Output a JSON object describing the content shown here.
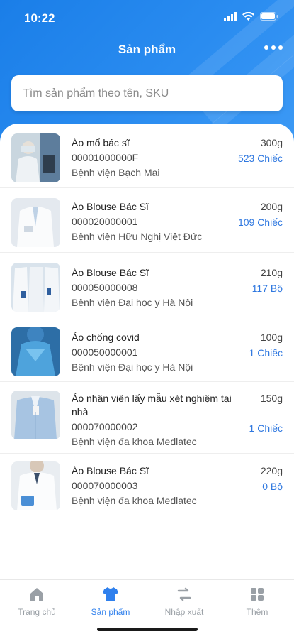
{
  "status": {
    "time": "10:22"
  },
  "header": {
    "title": "Sản phẩm"
  },
  "search": {
    "placeholder": "Tìm sản phẩm theo tên, SKU"
  },
  "products": [
    {
      "name": "Áo mổ bác sĩ",
      "sku": "00001000000F",
      "hospital": "Bệnh viện Bạch Mai",
      "weight": "300g",
      "quantity": "523 Chiếc"
    },
    {
      "name": "Áo Blouse Bác Sĩ",
      "sku": "000020000001",
      "hospital": "Bệnh viện Hữu Nghị Việt Đức",
      "weight": "200g",
      "quantity": "109 Chiếc"
    },
    {
      "name": "Áo Blouse Bác Sĩ",
      "sku": "000050000008",
      "hospital": "Bệnh viện Đại học y Hà Nội",
      "weight": "210g",
      "quantity": "117 Bộ"
    },
    {
      "name": "Áo chống covid",
      "sku": "000050000001",
      "hospital": "Bệnh viện Đại học y Hà Nội",
      "weight": "100g",
      "quantity": "1 Chiếc"
    },
    {
      "name": "Áo nhân viên lấy mẫu xét nghiệm tại nhà",
      "sku": "000070000002",
      "hospital": "Bệnh viện đa khoa Medlatec",
      "weight": "150g",
      "quantity": "1 Chiếc"
    },
    {
      "name": "Áo Blouse Bác Sĩ",
      "sku": "000070000003",
      "hospital": "Bệnh viện đa khoa Medlatec",
      "weight": "220g",
      "quantity": "0 Bộ"
    }
  ],
  "nav": [
    {
      "label": "Trang chủ",
      "icon": "home-icon",
      "active": false
    },
    {
      "label": "Sản phẩm",
      "icon": "shirt-icon",
      "active": true
    },
    {
      "label": "Nhập xuất",
      "icon": "swap-arrows-icon",
      "active": false
    },
    {
      "label": "Thêm",
      "icon": "grid-icon",
      "active": false
    }
  ],
  "colors": {
    "primary": "#2f80ed",
    "quantity": "#2f78e0",
    "inactive": "#9aa0a6"
  }
}
